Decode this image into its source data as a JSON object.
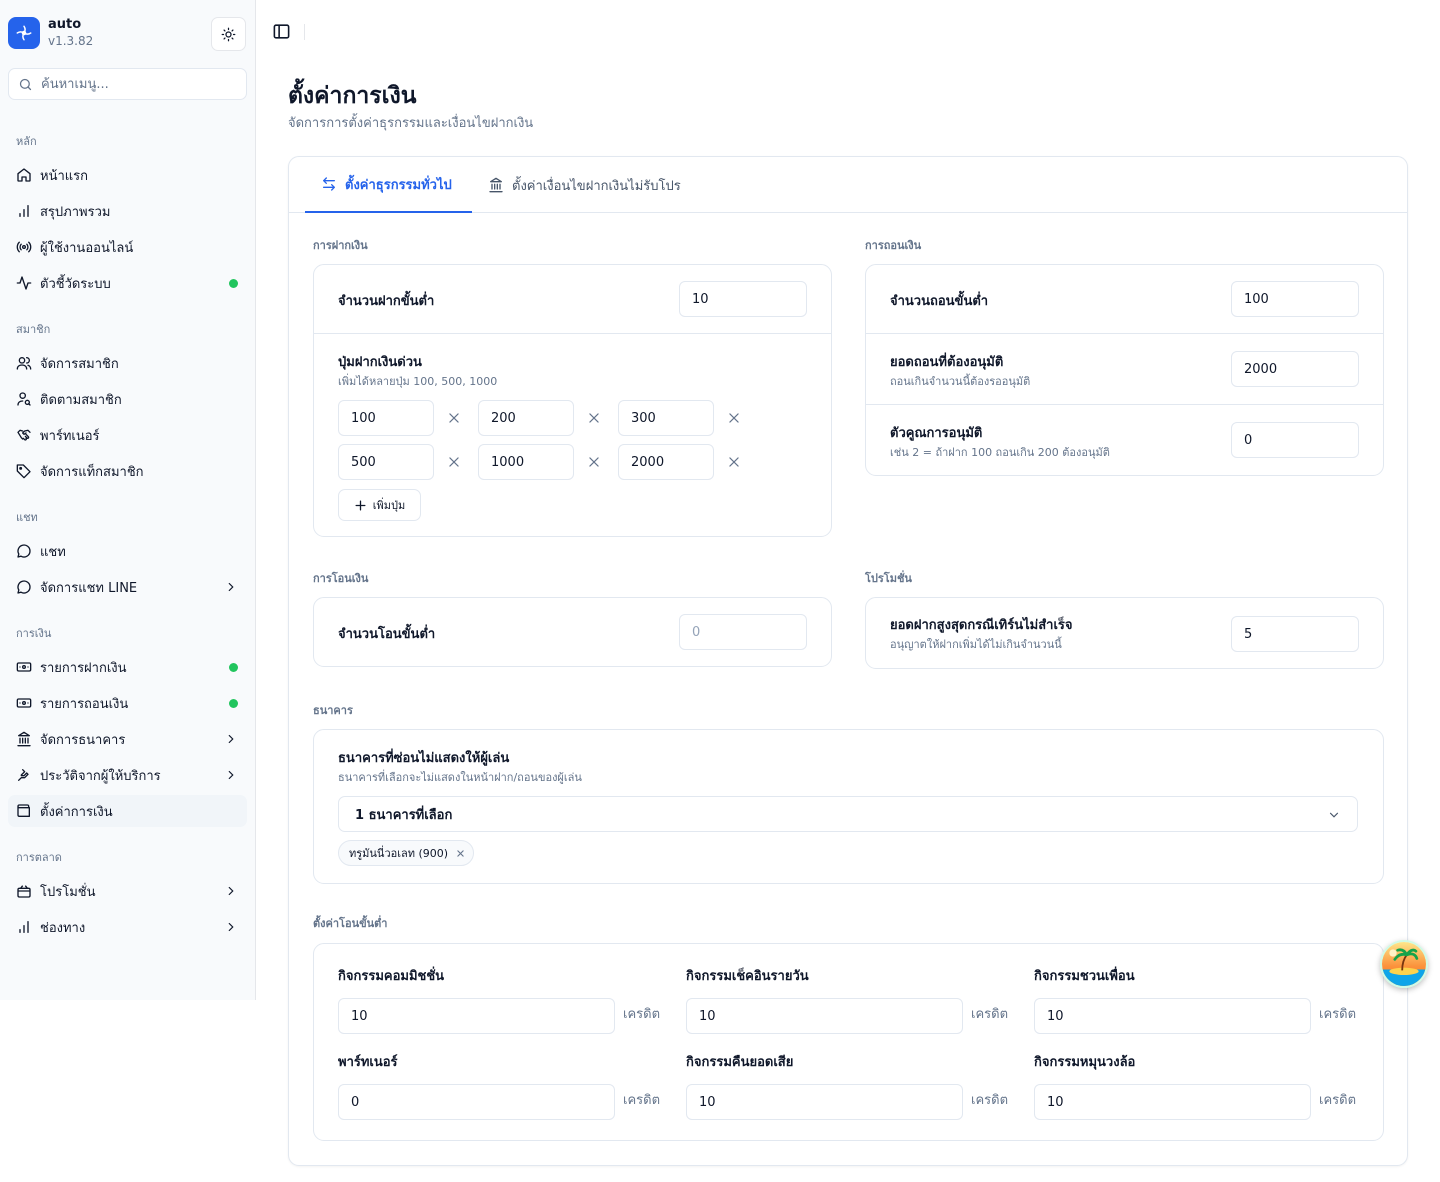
{
  "app": {
    "name": "auto",
    "version": "v1.3.82"
  },
  "sidebar": {
    "search_placeholder": "ค้นหาเมนู...",
    "groups": [
      {
        "label": "หลัก",
        "items": [
          {
            "label": "หน้าแรก",
            "icon": "home-icon"
          },
          {
            "label": "สรุปภาพรวม",
            "icon": "bar-chart-icon"
          },
          {
            "label": "ผู้ใช้งานออนไลน์",
            "icon": "radio-icon"
          },
          {
            "label": "ตัวชี้วัดระบบ",
            "icon": "activity-icon",
            "status": "online"
          }
        ]
      },
      {
        "label": "สมาชิก",
        "items": [
          {
            "label": "จัดการสมาชิก",
            "icon": "users-icon"
          },
          {
            "label": "ติดตามสมาชิก",
            "icon": "user-search-icon"
          },
          {
            "label": "พาร์ทเนอร์",
            "icon": "handshake-icon"
          },
          {
            "label": "จัดการแท็กสมาชิก",
            "icon": "tag-icon"
          }
        ]
      },
      {
        "label": "แชท",
        "items": [
          {
            "label": "แชท",
            "icon": "message-circle-icon"
          },
          {
            "label": "จัดการแชท LINE",
            "icon": "message-circle-icon",
            "has_submenu": true
          }
        ]
      },
      {
        "label": "การเงิน",
        "items": [
          {
            "label": "รายการฝากเงิน",
            "icon": "banknote-icon",
            "status": "online"
          },
          {
            "label": "รายการถอนเงิน",
            "icon": "banknote-icon",
            "status": "online"
          },
          {
            "label": "จัดการธนาคาร",
            "icon": "landmark-icon",
            "has_submenu": true
          },
          {
            "label": "ประวัติจากผู้ให้บริการ",
            "icon": "history-icon",
            "has_submenu": true
          },
          {
            "label": "ตั้งค่าการเงิน",
            "icon": "wallet-icon",
            "active": true
          }
        ]
      },
      {
        "label": "การตลาด",
        "items": [
          {
            "label": "โปรโมชั่น",
            "icon": "gift-icon",
            "has_submenu": true
          },
          {
            "label": "ช่องทาง",
            "icon": "bar-chart-icon",
            "has_submenu": true
          }
        ]
      }
    ]
  },
  "page": {
    "title": "ตั้งค่าการเงิน",
    "subtitle": "จัดการการตั้งค่าธุรกรรมและเงื่อนไขฝากเงิน"
  },
  "tabs": [
    {
      "label": "ตั้งค่าธุรกรรมทั่วไป",
      "active": true
    },
    {
      "label": "ตั้งค่าเงื่อนไขฝากเงินไม่รับโปร",
      "active": false
    }
  ],
  "deposit": {
    "section": "การฝากเงิน",
    "min_label": "จำนวนฝากขั้นต่ำ",
    "min_value": "10",
    "quick_label": "ปุ่มฝากเงินด่วน",
    "quick_hint": "เพิ่มได้หลายปุ่ม 100, 500, 1000",
    "quick_values": [
      "100",
      "200",
      "300",
      "500",
      "1000",
      "2000"
    ],
    "add_button": "เพิ่มปุ่ม"
  },
  "withdraw": {
    "section": "การถอนเงิน",
    "min_label": "จำนวนถอนขั้นต่ำ",
    "min_value": "100",
    "approve_label": "ยอดถอนที่ต้องอนุมัติ",
    "approve_hint": "ถอนเกินจำนวนนี้ต้องรออนุมัติ",
    "approve_value": "2000",
    "multiplier_label": "ตัวคูณการอนุมัติ",
    "multiplier_hint": "เช่น 2 = ถ้าฝาก 100 ถอนเกิน 200 ต้องอนุมัติ",
    "multiplier_value": "0"
  },
  "transfer": {
    "section": "การโอนเงิน",
    "min_label": "จำนวนโอนขั้นต่ำ",
    "min_placeholder": "0"
  },
  "promotion": {
    "section": "โปรโมชั่น",
    "max_label": "ยอดฝากสูงสุดกรณีเทิร์นไม่สำเร็จ",
    "max_hint": "อนุญาตให้ฝากเพิ่มได้ไม่เกินจำนวนนี้",
    "max_value": "5"
  },
  "bank": {
    "section": "ธนาคาร",
    "hidden_label": "ธนาคารที่ซ่อนไม่แสดงให้ผู้เล่น",
    "hidden_hint": "ธนาคารที่เลือกจะไม่แสดงในหน้าฝาก/ถอนของผู้เล่น",
    "select_value": "1 ธนาคารที่เลือก",
    "selected_chip": "ทรูมันนี่วอเลท (900)"
  },
  "min_transfer": {
    "section": "ตั้งค่าโอนขั้นต่ำ",
    "unit": "เครดิต",
    "fields": [
      {
        "label": "กิจกรรมคอมมิชชั่น",
        "value": "10"
      },
      {
        "label": "กิจกรรมเช็คอินรายวัน",
        "value": "10"
      },
      {
        "label": "กิจกรรมชวนเพื่อน",
        "value": "10"
      },
      {
        "label": "พาร์ทเนอร์",
        "value": "0"
      },
      {
        "label": "กิจกรรมคืนยอดเสีย",
        "value": "10"
      },
      {
        "label": "กิจกรรมหมุนวงล้อ",
        "value": "10"
      }
    ]
  },
  "colors": {
    "accent": "#2563eb",
    "status_online": "#22c55e",
    "text": "#0f172a",
    "muted": "#64748b",
    "border": "#e2e8f0"
  }
}
